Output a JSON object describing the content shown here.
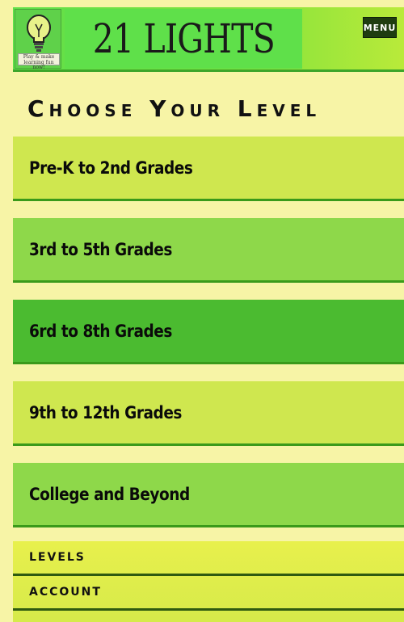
{
  "header": {
    "logo_tagline": "Play & make learning fun now!",
    "title": "21 LIGHTS",
    "menu_label": "MENU"
  },
  "main": {
    "heading": "Choose Your Level",
    "levels": [
      {
        "label": "Pre-K to 2nd Grades",
        "color": "#cfe74f"
      },
      {
        "label": "3rd to 5th Grades",
        "color": "#8ed84a"
      },
      {
        "label": "6rd to 8th Grades",
        "color": "#4bbb30"
      },
      {
        "label": "9th to 12th Grades",
        "color": "#cfe74f"
      },
      {
        "label": "College and Beyond",
        "color": "#8ed84a"
      }
    ]
  },
  "bottom_nav": {
    "items": [
      {
        "label": "LEVELS"
      },
      {
        "label": "ACCOUNT"
      }
    ]
  }
}
